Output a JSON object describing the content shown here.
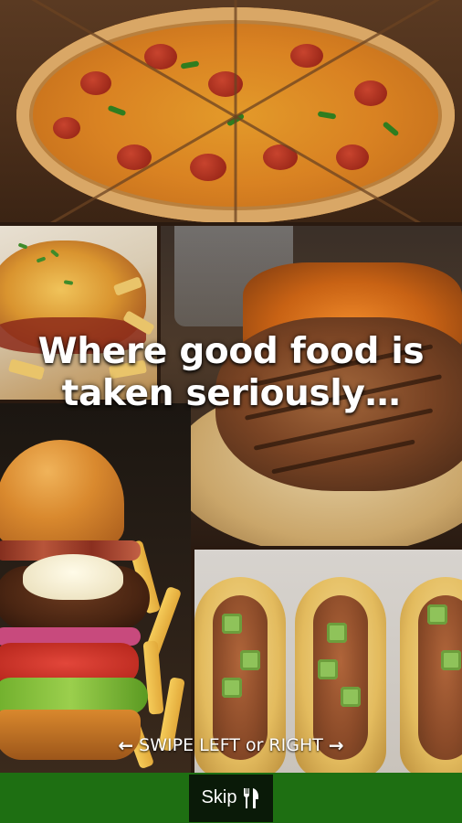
{
  "collage": {
    "headline_line1": "Where good food is",
    "headline_line2": "taken seriously…",
    "images": [
      {
        "subject": "pizza",
        "icon": "pizza-photo"
      },
      {
        "subject": "parmigiana",
        "icon": "parmigiana-photo"
      },
      {
        "subject": "grilled chicken with fries",
        "icon": "steak-photo"
      },
      {
        "subject": "burger with fries",
        "icon": "burger-photo"
      },
      {
        "subject": "tacos",
        "icon": "tacos-photo"
      }
    ]
  },
  "swipe": {
    "left_arrow": "←",
    "label": "SWIPE LEFT or RIGHT",
    "right_arrow": "→"
  },
  "bottom_bar": {
    "skip_label": "Skip",
    "skip_icon": "fork-knife-icon",
    "bar_color": "#1e6f12"
  }
}
